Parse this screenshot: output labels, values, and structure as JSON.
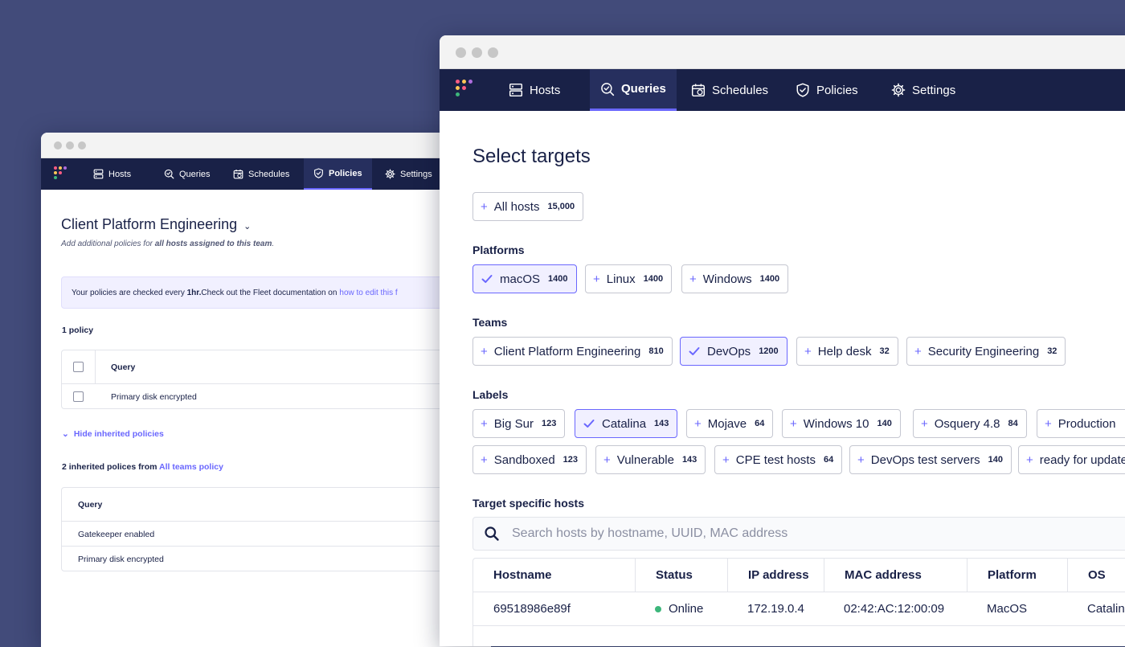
{
  "back_window": {
    "nav": [
      {
        "label": "Hosts",
        "icon": "server-icon",
        "active": false
      },
      {
        "label": "Queries",
        "icon": "query-icon",
        "active": false
      },
      {
        "label": "Schedules",
        "icon": "schedule-icon",
        "active": false
      },
      {
        "label": "Policies",
        "icon": "shield-icon",
        "active": true
      },
      {
        "label": "Settings",
        "icon": "gear-icon",
        "active": false
      }
    ],
    "team_title": "Client Platform Engineering",
    "subtitle_prefix": "Add additional policies for ",
    "subtitle_bold": "all hosts assigned to this team",
    "subtitle_suffix": ".",
    "banner_prefix": "Your policies are checked every ",
    "banner_bold": "1hr.",
    "banner_middle": " Check out the Fleet documentation on",
    "banner_link": "how to edit this f",
    "policy_count": "1 policy",
    "table1_header": "Query",
    "table1_rows": [
      "Primary disk encrypted"
    ],
    "toggle_inherited": "Hide inherited policies",
    "inherited_prefix": "2 inherited polices from ",
    "inherited_link": "All teams policy",
    "table2_header": "Query",
    "table2_rows": [
      "Gatekeeper enabled",
      "Primary disk encrypted"
    ]
  },
  "front_window": {
    "nav": [
      {
        "label": "Hosts",
        "icon": "server-icon",
        "active": false
      },
      {
        "label": "Queries",
        "icon": "query-icon",
        "active": true
      },
      {
        "label": "Schedules",
        "icon": "schedule-icon",
        "active": false
      },
      {
        "label": "Policies",
        "icon": "shield-icon",
        "active": false
      },
      {
        "label": "Settings",
        "icon": "gear-icon",
        "active": false
      }
    ],
    "title": "Select targets",
    "all_hosts": {
      "label": "All hosts",
      "count": "15,000"
    },
    "platforms_label": "Platforms",
    "platforms": [
      {
        "label": "macOS",
        "count": "1400",
        "selected": true
      },
      {
        "label": "Linux",
        "count": "1400",
        "selected": false
      },
      {
        "label": "Windows",
        "count": "1400",
        "selected": false
      }
    ],
    "teams_label": "Teams",
    "teams": [
      {
        "label": "Client Platform Engineering",
        "count": "810",
        "selected": false
      },
      {
        "label": "DevOps",
        "count": "1200",
        "selected": true
      },
      {
        "label": "Help desk",
        "count": "32",
        "selected": false
      },
      {
        "label": "Security Engineering",
        "count": "32",
        "selected": false
      }
    ],
    "labels_label": "Labels",
    "labels_row1": [
      {
        "label": "Big Sur",
        "count": "123",
        "selected": false
      },
      {
        "label": "Catalina",
        "count": "143",
        "selected": true
      },
      {
        "label": "Mojave",
        "count": "64",
        "selected": false
      },
      {
        "label": "Windows 10",
        "count": "140",
        "selected": false
      },
      {
        "label": "Osquery 4.8",
        "count": "84",
        "selected": false
      },
      {
        "label": "Production",
        "count": "",
        "selected": false
      }
    ],
    "labels_row2": [
      {
        "label": "Sandboxed",
        "count": "123",
        "selected": false
      },
      {
        "label": "Vulnerable",
        "count": "143",
        "selected": false
      },
      {
        "label": "CPE test hosts",
        "count": "64",
        "selected": false
      },
      {
        "label": "DevOps test servers",
        "count": "140",
        "selected": false
      },
      {
        "label": "ready for update",
        "count": "",
        "selected": false
      }
    ],
    "specific_label": "Target specific hosts",
    "search_placeholder": "Search hosts by hostname, UUID, MAC address",
    "table_headers": [
      "Hostname",
      "Status",
      "IP address",
      "MAC address",
      "Platform",
      "OS"
    ],
    "table_rows": [
      [
        "69518986e89f",
        "Online",
        "172.19.0.4",
        "02:42:AC:12:00:09",
        "MacOS",
        "Catalina"
      ]
    ],
    "colors": {
      "accent": "#6a67fe",
      "nav_bg": "#192147",
      "online": "#3db67b"
    }
  }
}
